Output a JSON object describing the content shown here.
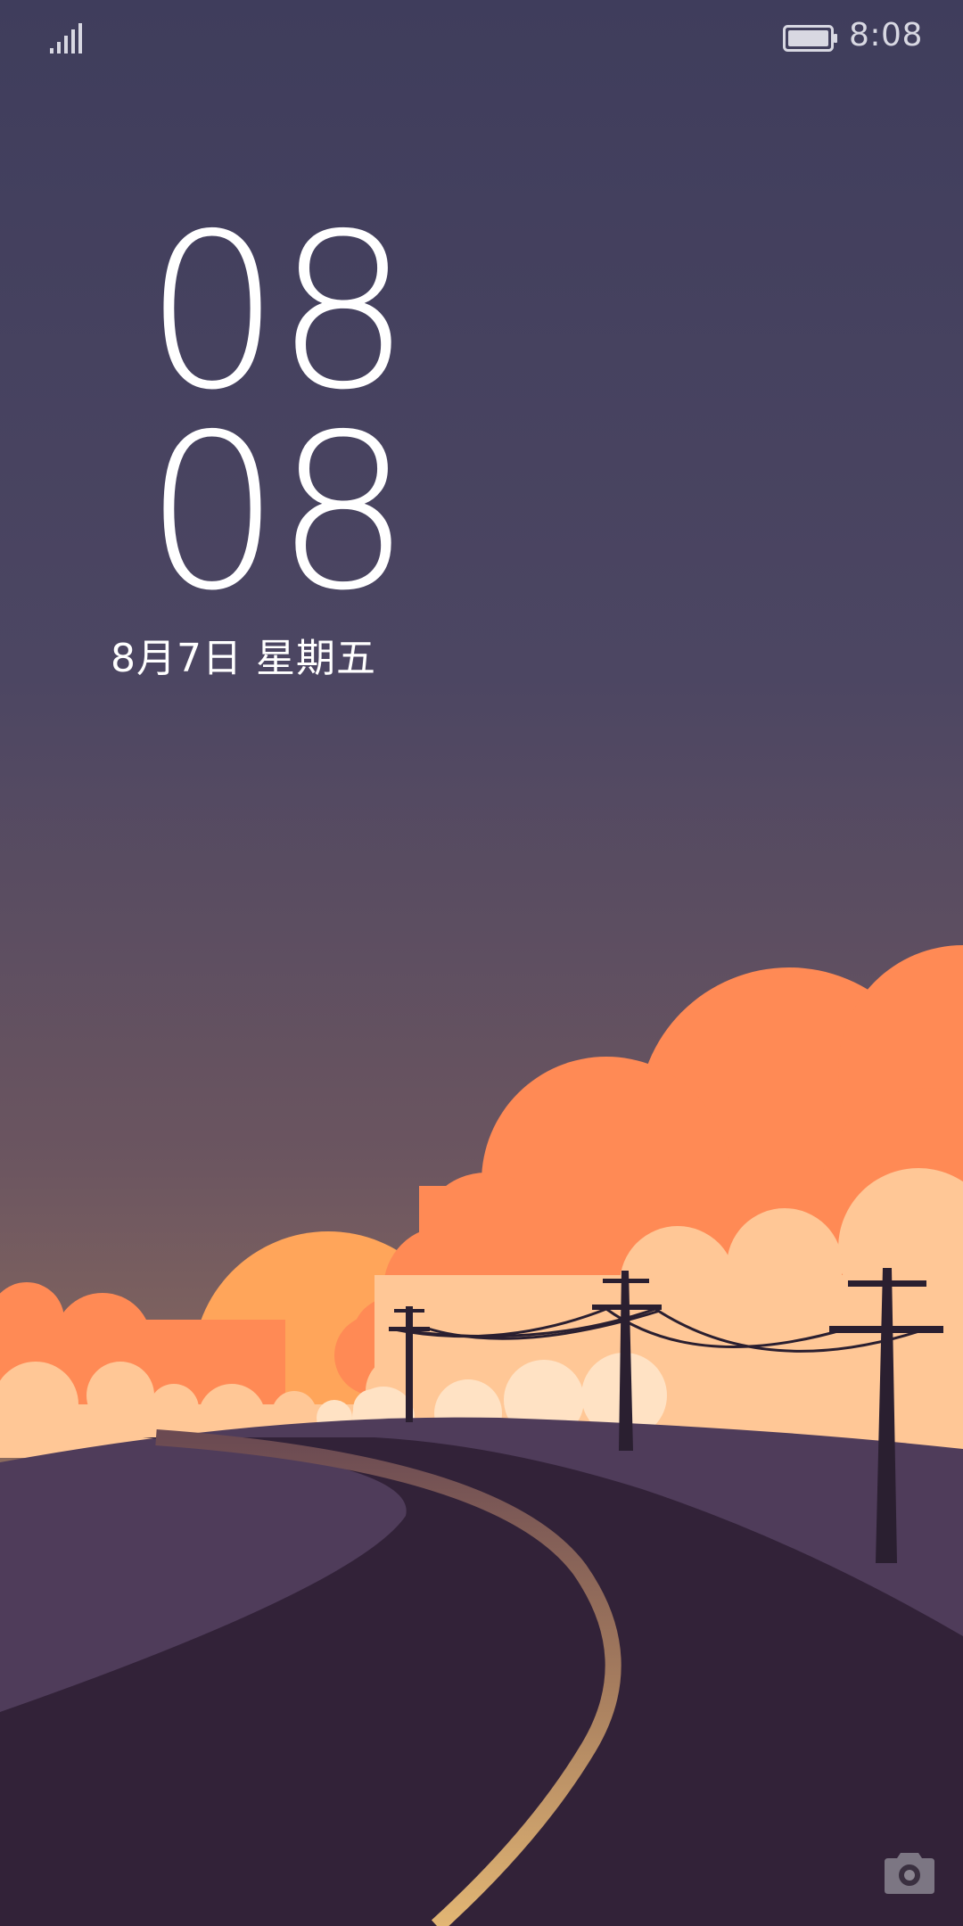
{
  "status_bar": {
    "time": "8:08",
    "signal_icon": "signal-bars-icon",
    "battery_icon": "battery-full-icon"
  },
  "lock_clock": {
    "hours": "08",
    "minutes": "08",
    "date": "8月7日 星期五"
  },
  "shortcuts": {
    "camera_icon": "camera-icon"
  },
  "colors": {
    "sky_top": "#3f3d5c",
    "sky_bottom": "#7a6060",
    "sun": "#ffa55a",
    "cloud_orange": "#ff8a55",
    "cloud_light": "#ffc796",
    "hill": "#4f3c5a",
    "road": "#322238",
    "road_line": "#d9ad70"
  }
}
